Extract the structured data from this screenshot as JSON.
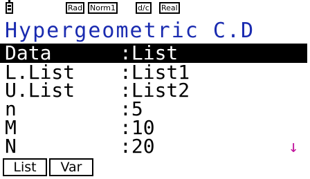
{
  "status_bar": {
    "battery_icon": "battery-icon",
    "angle": "Rad",
    "display": "Norm1",
    "fraction": "d/c",
    "complex": "Real"
  },
  "title": "Hypergeometric C.D",
  "rows": [
    {
      "label": "Data",
      "value": ":List",
      "selected": true
    },
    {
      "label": "L.List",
      "value": ":List1"
    },
    {
      "label": "U.List",
      "value": ":List2"
    },
    {
      "label": "n",
      "value": ":5"
    },
    {
      "label": "M",
      "value": ":10"
    },
    {
      "label": "N",
      "value": ":20"
    }
  ],
  "scroll_indicator": "↓",
  "function_keys": [
    {
      "label": "List"
    },
    {
      "label": "Var"
    }
  ],
  "colors": {
    "title": "#1a2bb0",
    "scroll_arrow": "#c2189e",
    "selection_bg": "#000000"
  }
}
